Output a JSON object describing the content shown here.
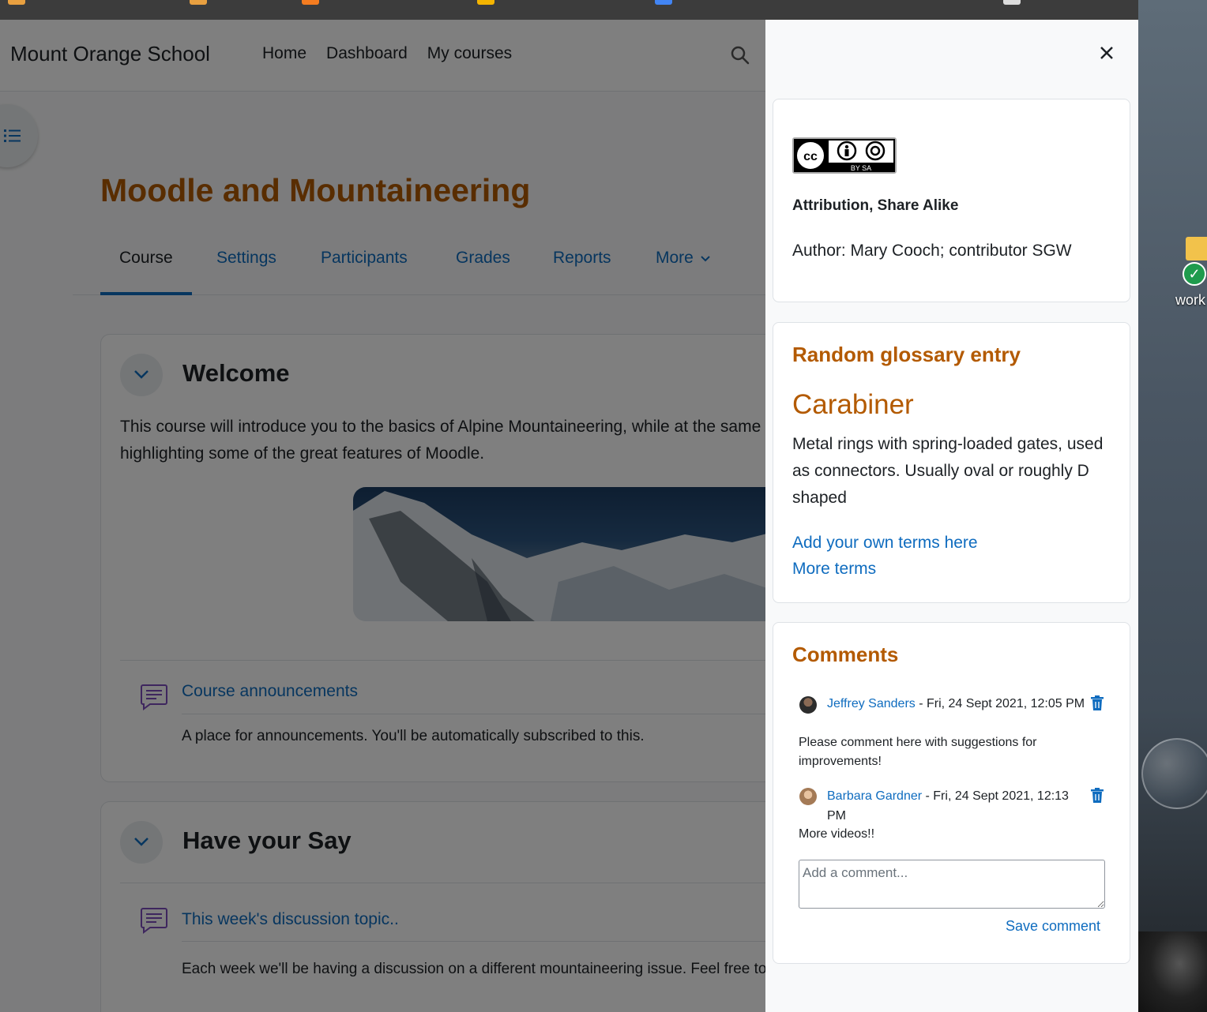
{
  "site": {
    "name": "Mount Orange School"
  },
  "nav": {
    "links": [
      "Home",
      "Dashboard",
      "My courses"
    ]
  },
  "course": {
    "title": "Moodle and Mountaineering",
    "tabs": [
      "Course",
      "Settings",
      "Participants",
      "Grades",
      "Reports",
      "More"
    ],
    "active_tab": "Course"
  },
  "sections": [
    {
      "title": "Welcome",
      "summary": "This course will introduce you to the basics of Alpine Mountaineering, while at the same time highlighting some of the great features of Moodle.",
      "activity": {
        "name": "Course announcements",
        "description": "A place for announcements. You'll be automatically subscribed to this."
      }
    },
    {
      "title": "Have your Say",
      "activity": {
        "name": "This week's discussion topic..",
        "description": "Each week we'll be having a discussion on a different mountaineering issue. Feel free to join in."
      }
    }
  ],
  "drawer": {
    "license": {
      "badge_text": "BY SA",
      "title": "Attribution, Share Alike",
      "author": "Author: Mary Cooch; contributor SGW"
    },
    "glossary": {
      "heading": "Random glossary entry",
      "term": "Carabiner",
      "definition": "Metal rings with spring-loaded gates, used as connectors. Usually oval or roughly D shaped",
      "links": [
        "Add your own terms here",
        "More terms"
      ]
    },
    "comments": {
      "heading": "Comments",
      "items": [
        {
          "author": "Jeffrey Sanders",
          "date": " - Fri, 24 Sept 2021, 12:05 PM",
          "text": "Please comment here with suggestions for improvements!"
        },
        {
          "author": "Barbara Gardner",
          "date": " - Fri, 24 Sept 2021, 12:13 PM",
          "text": "More videos!!"
        }
      ],
      "input_placeholder": "Add a comment...",
      "save_label": "Save comment"
    }
  },
  "desktop": {
    "folder_label": "work"
  },
  "colors": {
    "accent": "#0f6cbf",
    "heading": "#b35a00",
    "text": "#1d2125"
  }
}
